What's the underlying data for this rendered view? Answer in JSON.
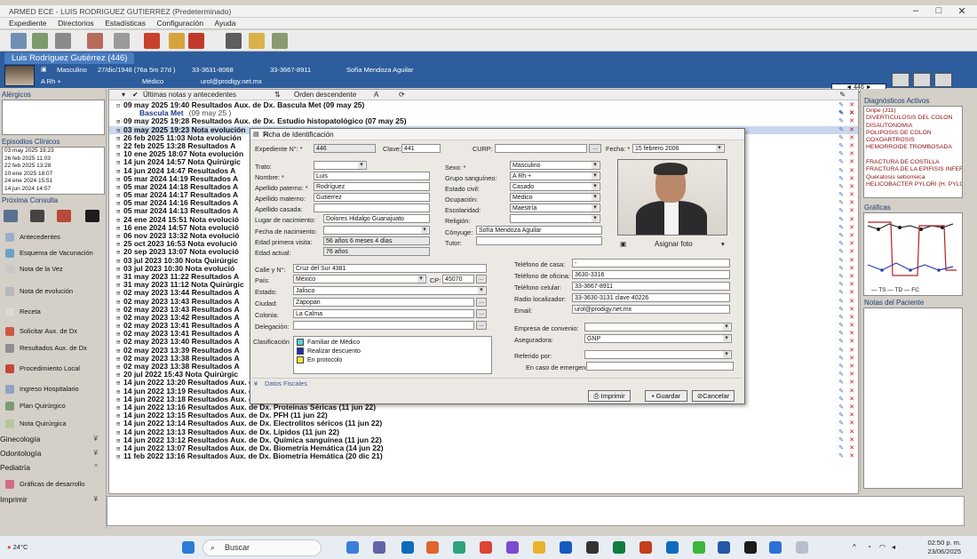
{
  "window": {
    "title": "ARMED ECE - LUIS RODRIGUEZ GUTIERREZ (Predeterminado)",
    "menu": [
      "Expediente",
      "Directorios",
      "Estadísticas",
      "Configuración",
      "Ayuda"
    ]
  },
  "patient": {
    "tab_label": "Luis Rodríguez Gutiérrez (446)",
    "sex": "Masculino",
    "birth": "27/dic/1948 (76a 5m 27d )",
    "phone1": "33-3631-8068",
    "phone2": "33-3667-8911",
    "spouse": "Sofía Mendoza Aguilar",
    "blood": "A Rh +",
    "role": "Médico",
    "email": "urol@prodigy.net.mx",
    "nav_number": "446"
  },
  "sidebar": {
    "alergicos": "Alérgicos",
    "episodios_label": "Episodios Clínicos",
    "episodios": [
      "03 may 2025 19:23",
      "26 feb 2025 11:03",
      "22 feb 2025 13:28",
      "10 ene 2025 18:07",
      "24 ene 2024 15:51",
      "14 jun 2024 14:57"
    ],
    "proxima": "Próxima Consulta",
    "nav": [
      "Antecedentes",
      "Esquema de Vacunación",
      "Nota de la Vez",
      "Nota de evolución",
      "Receta",
      "Solicitar Aux. de Dx",
      "Resultados Aux. de Dx",
      "Procedimiento Local",
      "Ingreso Hospitalario",
      "Plan Quirúrgico",
      "Nota Quirúrgica"
    ],
    "sections": [
      "Ginecología",
      "Odontología",
      "Pediatría",
      "Gráficas de desarrollo",
      "Imprimir"
    ]
  },
  "center": {
    "toolbar": {
      "latest": "Últimas notas y antecedentes",
      "order": "Orden descendente"
    },
    "notes": [
      {
        "exp": "⊟",
        "dt": "09 may 2025 19:40",
        "title": "Resultados Aux. de Dx. Bascula Met (09 may 25)"
      },
      {
        "sub": true,
        "title": "Bascula Met",
        "tail": "(09 may 25 )"
      },
      {
        "exp": "⊞",
        "dt": "09 may 2025 19:28",
        "title": "Resultados Aux. de Dx. Estudio histopatológico (07 may 25)"
      },
      {
        "exp": "⊞",
        "dt": "03 may 2025 19:23",
        "title": "Nota evolución",
        "sel": true
      },
      {
        "exp": "⊞",
        "dt": "26 feb 2025 11:03",
        "title": "Nota evolución"
      },
      {
        "exp": "⊞",
        "dt": "22 feb 2025 13:28",
        "title": "Resultados A"
      },
      {
        "exp": "⊞",
        "dt": "10 ene 2025 18:07",
        "title": "Nota evolución"
      },
      {
        "exp": "⊞",
        "dt": "14 jun 2024 14:57",
        "title": "Nota Quirúrgic"
      },
      {
        "exp": "⊞",
        "dt": "14 jun 2024 14:47",
        "title": "Resultados A"
      },
      {
        "exp": "⊞",
        "dt": "05 mar 2024 14:19",
        "title": "Resultados A"
      },
      {
        "exp": "⊞",
        "dt": "05 mar 2024 14:18",
        "title": "Resultados A"
      },
      {
        "exp": "⊞",
        "dt": "05 mar 2024 14:17",
        "title": "Resultados A"
      },
      {
        "exp": "⊞",
        "dt": "05 mar 2024 14:16",
        "title": "Resultados A"
      },
      {
        "exp": "⊞",
        "dt": "05 mar 2024 14:13",
        "title": "Resultados A"
      },
      {
        "exp": "⊞",
        "dt": "24 ene 2024 15:51",
        "title": "Nota evolució"
      },
      {
        "exp": "⊞",
        "dt": "16 ene 2024 14:57",
        "title": "Nota evolució"
      },
      {
        "exp": "⊞",
        "dt": "06 nov 2023 13:32",
        "title": "Nota evolució"
      },
      {
        "exp": "⊞",
        "dt": "25 oct 2023 16:53",
        "title": "Nota evolució"
      },
      {
        "exp": "⊞",
        "dt": "20 sep 2023 13:07",
        "title": "Nota evolució"
      },
      {
        "exp": "⊞",
        "dt": "03 jul 2023 10:30",
        "title": "Nota Quirúrgic"
      },
      {
        "exp": "⊞",
        "dt": "03 jul 2023 10:30",
        "title": "Nota evolució"
      },
      {
        "exp": "⊞",
        "dt": "31 may 2023 11:22",
        "title": "Resultados A"
      },
      {
        "exp": "⊞",
        "dt": "31 may 2023 11:12",
        "title": "Nota Quirúrgic"
      },
      {
        "exp": "⊞",
        "dt": "02 may 2023 13:44",
        "title": "Resultados A"
      },
      {
        "exp": "⊞",
        "dt": "02 may 2023 13:43",
        "title": "Resultados A"
      },
      {
        "exp": "⊞",
        "dt": "02 may 2023 13:43",
        "title": "Resultados A"
      },
      {
        "exp": "⊞",
        "dt": "02 may 2023 13:42",
        "title": "Resultados A"
      },
      {
        "exp": "⊞",
        "dt": "02 may 2023 13:41",
        "title": "Resultados A"
      },
      {
        "exp": "⊞",
        "dt": "02 may 2023 13:41",
        "title": "Resultados A"
      },
      {
        "exp": "⊞",
        "dt": "02 may 2023 13:40",
        "title": "Resultados A"
      },
      {
        "exp": "⊞",
        "dt": "02 may 2023 13:39",
        "title": "Resultados A"
      },
      {
        "exp": "⊞",
        "dt": "02 may 2023 13:38",
        "title": "Resultados A"
      },
      {
        "exp": "⊞",
        "dt": "02 may 2023 13:38",
        "title": "Resultados A"
      },
      {
        "exp": "⊞",
        "dt": "20 jul 2022 15:43",
        "title": "Nota Quirúrgic"
      },
      {
        "exp": "⊞",
        "dt": "14 jun 2022 13:20",
        "title": "Resultados Aux. de Dx. Hormonas Hombres (11 jun 22)"
      },
      {
        "exp": "⊞",
        "dt": "14 jun 2022 13:19",
        "title": "Resultados Aux. de Dx. Antígeno Prostata especifico (11 jun 22)"
      },
      {
        "exp": "⊞",
        "dt": "14 jun 2022 13:18",
        "title": "Resultados Aux. de Dx. Exámen General de Orina (14 jun 22)"
      },
      {
        "exp": "⊞",
        "dt": "14 jun 2022 13:16",
        "title": "Resultados Aux. de Dx. Proteinas Séricas (11 jun 22)"
      },
      {
        "exp": "⊞",
        "dt": "14 jun 2022 13:15",
        "title": "Resultados Aux. de Dx. PFH (11 jun 22)"
      },
      {
        "exp": "⊞",
        "dt": "14 jun 2022 13:14",
        "title": "Resultados Aux. de Dx. Electrolitos séricos (11 jun 22)"
      },
      {
        "exp": "⊞",
        "dt": "14 jun 2022 13:13",
        "title": "Resultados Aux. de Dx. Lípidos (11 jun 22)"
      },
      {
        "exp": "⊞",
        "dt": "14 jun 2022 13:12",
        "title": "Resultados Aux. de Dx. Química sanguínea (11 jun 22)"
      },
      {
        "exp": "⊞",
        "dt": "14 jun 2022 13:07",
        "title": "Resultados Aux. de Dx. Biometría Hemática (14 jun 22)"
      },
      {
        "exp": "⊞",
        "dt": "11 feb 2022 13:16",
        "title": "Resultados Aux. de Dx. Biometría Hemática (20 dic 21)"
      }
    ]
  },
  "rightpanel": {
    "diag_label": "Diagnósticos Activos",
    "diagnosticos": [
      "Gripe (J11)",
      "DIVERTICULOSIS DEL COLON",
      "DISAUTONOMIA",
      "POLIPOSIS DE COLON",
      "COXOARTROSIS",
      "HEMORROIDE TROMBOSADA",
      "",
      "FRACTURA DE COSTILLA",
      "FRACTURA DE LA EPIFISIS INFER",
      "Queratosis seborreica",
      "HELICOBACTER PYLORI (H. PYLO"
    ],
    "graficas_label": "Gráficas",
    "legend": "— TS — TD — FC",
    "notas_label": "Notas del Paciente"
  },
  "dialog": {
    "title": "Ficha de Identificación",
    "labels": {
      "expediente": "Expediente N°: *",
      "clave": "Clave:",
      "curp": "CURP:",
      "fecha": "Fecha: *",
      "trato": "Trato:",
      "nombre": "Nombre: *",
      "ap_paterno": "Apellido paterno: *",
      "ap_materno": "Apellido materno:",
      "ap_casada": "Apellido casada:",
      "lugar_nac": "Lugar de nacimiento:",
      "fecha_nac": "Fecha de nacimiento:",
      "edad_primera": "Edad primera visita:",
      "edad_actual": "Edad actual:",
      "sexo": "Sexo: *",
      "grupo": "Grupo sanguíneo:",
      "estado_civil": "Estado civil:",
      "ocupacion": "Ocupación:",
      "escolaridad": "Escolaridad:",
      "religion": "Religión:",
      "conyuge": "Cónyuge:",
      "tutor": "Tutor:",
      "calle": "Calle y N°:",
      "pais": "País:",
      "cp": "CP:",
      "estado": "Estado:",
      "ciudad": "Ciudad:",
      "colonia": "Colonia:",
      "delegacion": "Delegación:",
      "clasificacion": "Clasificación",
      "tel_casa": "Teléfono de casa:",
      "tel_oficina": "Teléfono de oficina:",
      "tel_celular": "Teléfono celular:",
      "radio": "Radio localizador:",
      "email": "Email:",
      "empresa": "Empresa de convenio:",
      "aseguradora": "Aseguradora:",
      "referido": "Referido por:",
      "emergencia": "En caso de emergencia:",
      "asignar_foto": "Asignar foto",
      "datos_fiscales": "Datos Fiscales"
    },
    "values": {
      "expediente": "446",
      "clave": "441",
      "curp": "",
      "fecha": "15 febrero 2006",
      "trato": "",
      "nombre": "Luis",
      "ap_paterno": "Rodríguez",
      "ap_materno": "Gutiérrez",
      "ap_casada": "",
      "lugar_nac": "Dolores Hidalgo Guanajuato",
      "fecha_nac": "",
      "edad_primera": "56 años 6 meses 4 días",
      "edad_actual": "76 años",
      "sexo": "Masculino",
      "grupo": "A Rh +",
      "estado_civil": "Casado",
      "ocupacion": "Médico",
      "escolaridad": "Maestría",
      "religion": "",
      "conyuge": "Sofía Mendoza Aguilar",
      "tutor": "",
      "calle": "Cruz del Sur 4381",
      "pais": "México",
      "cp": "45070",
      "estado": "Jalisco",
      "ciudad": "Zapopan",
      "colonia": "La Calma",
      "delegacion": "",
      "tel_casa": "-",
      "tel_oficina": "3630-3316",
      "tel_celular": "33-3667-8911",
      "radio": "33-3630-3131 clave 40226",
      "email": "urol@prodigy.net.mx",
      "empresa": "",
      "aseguradora": "GNP",
      "referido": "",
      "emergencia": ""
    },
    "clasificacion": [
      {
        "label": "Familiar de Médico",
        "color": "#4fd1d9"
      },
      {
        "label": "Realizar descuento",
        "color": "#1a2fb0"
      },
      {
        "label": "En protocolo",
        "color": "#f3ea2a"
      }
    ],
    "buttons": {
      "print": "Imprimir",
      "save": "Guardar",
      "cancel": "Cancelar"
    }
  },
  "taskbar": {
    "temp": "24°C",
    "search": "Buscar",
    "time": "02:50 p. m.",
    "date": "23/06/2025"
  }
}
